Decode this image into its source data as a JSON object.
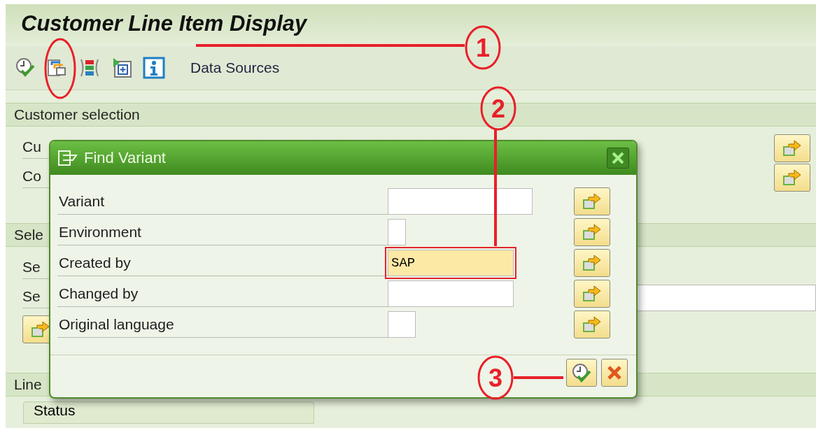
{
  "title": "Customer Line Item Display",
  "toolbar": {
    "link": "Data Sources"
  },
  "sections": [
    {
      "header": "Customer selection",
      "rows": [
        "Cu",
        "Co"
      ]
    },
    {
      "header": "Sele",
      "rows": [
        "Se",
        "Se"
      ]
    },
    {
      "header": "Line",
      "tab": "Status"
    }
  ],
  "dialog": {
    "title": "Find Variant",
    "fields": [
      {
        "label": "Variant",
        "focused": false
      },
      {
        "label": "Environment",
        "focused": false
      },
      {
        "label": "Created by",
        "value": "SAP",
        "focused": true
      },
      {
        "label": "Changed by",
        "focused": false
      },
      {
        "label": "Original language",
        "focused": false
      }
    ]
  },
  "annotations": [
    {
      "number": "1"
    },
    {
      "number": "2"
    },
    {
      "number": "3"
    }
  ]
}
